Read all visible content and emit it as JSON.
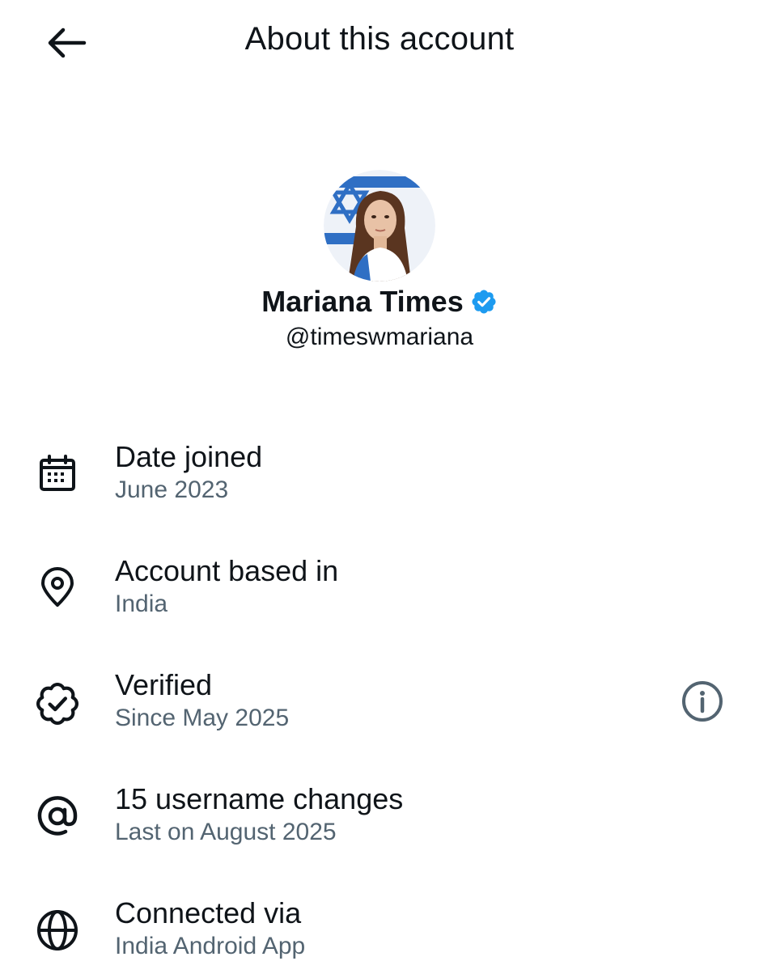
{
  "header": {
    "title": "About this account",
    "back_icon": "arrow-left-icon"
  },
  "profile": {
    "display_name": "Mariana Times",
    "handle": "@timeswmariana",
    "verified": true,
    "verified_color": "#1d9bf0"
  },
  "info": {
    "date_joined": {
      "label": "Date joined",
      "value": "June 2023",
      "icon": "calendar-icon"
    },
    "based_in": {
      "label": "Account based in",
      "value": "India",
      "icon": "location-pin-icon"
    },
    "verified": {
      "label": "Verified",
      "value": "Since May 2025",
      "icon": "verified-badge-icon",
      "action_icon": "info-icon"
    },
    "username_changes": {
      "label": "15 username changes",
      "value": "Last on August 2025",
      "icon": "at-sign-icon"
    },
    "connected_via": {
      "label": "Connected via",
      "value": "India Android App",
      "icon": "globe-icon"
    }
  },
  "colors": {
    "primary_text": "#0f1419",
    "secondary_text": "#536471",
    "accent": "#1d9bf0"
  }
}
